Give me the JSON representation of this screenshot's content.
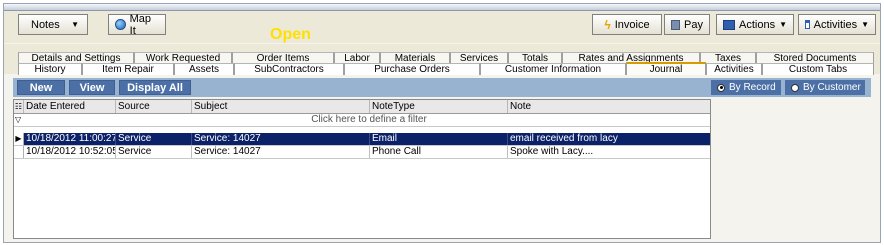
{
  "toolbar": {
    "notes_label": "Notes",
    "mapit_label": "Map It",
    "status_text": "Open",
    "invoice_label": "Invoice",
    "pay_label": "Pay",
    "actions_label": "Actions",
    "activities_label": "Activities"
  },
  "tabs_row1": [
    "Details and Settings",
    "Work Requested",
    "Order Items",
    "Labor",
    "Materials",
    "Services",
    "Totals",
    "Rates and Assignments",
    "Taxes",
    "Stored Documents"
  ],
  "tabs_row2": [
    "History",
    "Item Repair",
    "Assets",
    "SubContractors",
    "Purchase Orders",
    "Customer Information",
    "Journal",
    "Activities",
    "Custom Tabs"
  ],
  "active_tab": "Journal",
  "actionbar": {
    "new_label": "New",
    "view_label": "View",
    "display_all_label": "Display All",
    "by_record_label": "By Record",
    "by_customer_label": "By Customer",
    "selected_filter": "By Record"
  },
  "grid": {
    "columns": [
      "Date Entered",
      "Source",
      "Subject",
      "NoteType",
      "Note"
    ],
    "filter_prompt": "Click here to define a filter",
    "rows": [
      [
        "10/18/2012 11:00:27 ...",
        "Service",
        "Service: 14027",
        "Email",
        "email received from lacy"
      ],
      [
        "10/18/2012 10:52:05 ...",
        "Service",
        "Service: 14027",
        "Phone Call",
        "Spoke with Lacy...."
      ]
    ],
    "selected_row": 0
  },
  "colors": {
    "status_text": "#ffe000",
    "action_bar": "#98b3d0",
    "action_button": "#4c70a6",
    "selected_row": "#0b2168",
    "active_tab_accent": "#d89a00"
  }
}
